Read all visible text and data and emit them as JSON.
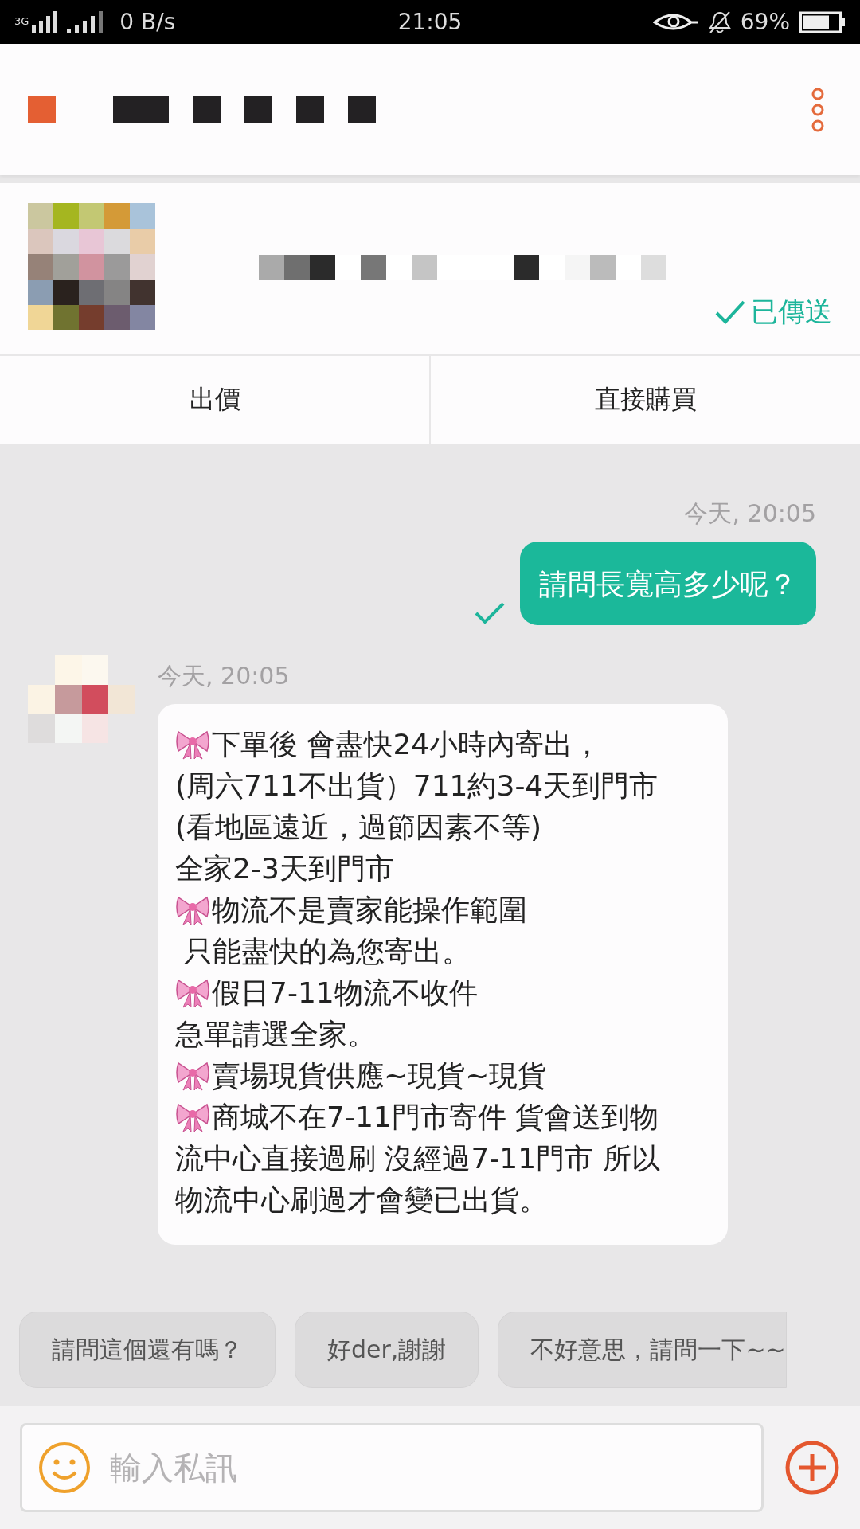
{
  "status_bar": {
    "network": "3G",
    "speed": "0 B/s",
    "time": "21:05",
    "battery": "69%"
  },
  "product": {
    "status": "已傳送",
    "actions": [
      "出價",
      "直接購買"
    ]
  },
  "messages": [
    {
      "kind": "outgoing",
      "time": "今天, 20:05",
      "lines": [
        {
          "kind": "plain",
          "text": "請問長寬高多少呢？"
        }
      ],
      "delivered": true
    },
    {
      "kind": "incoming",
      "time": "今天, 20:05",
      "lines": [
        {
          "kind": "bow",
          "text": "下單後 會盡快24小時內寄出，"
        },
        {
          "kind": "plain",
          "text": "(周六711不出貨）711約3-4天到門市"
        },
        {
          "kind": "plain",
          "text": "(看地區遠近，過節因素不等)"
        },
        {
          "kind": "plain",
          "text": "全家2-3天到門市"
        },
        {
          "kind": "bow",
          "text": "物流不是賣家能操作範圍"
        },
        {
          "kind": "plain",
          "text": " 只能盡快的為您寄出。"
        },
        {
          "kind": "bow",
          "text": "假日7-11物流不收件"
        },
        {
          "kind": "plain",
          "text": "急單請選全家。"
        },
        {
          "kind": "bow",
          "text": "賣場現貨供應~現貨~現貨"
        },
        {
          "kind": "bow",
          "text": "商城不在7-11門市寄件 貨會送到物"
        },
        {
          "kind": "plain",
          "text": "流中心直接過刷 沒經過7-11門市 所以"
        },
        {
          "kind": "plain",
          "text": "物流中心刷過才會變已出貨。"
        }
      ]
    }
  ],
  "quick_replies": [
    "請問這個還有嗎？",
    "好der,謝謝",
    "不好意思，請問一下~~"
  ],
  "composer": {
    "placeholder": "輸入私訊"
  }
}
